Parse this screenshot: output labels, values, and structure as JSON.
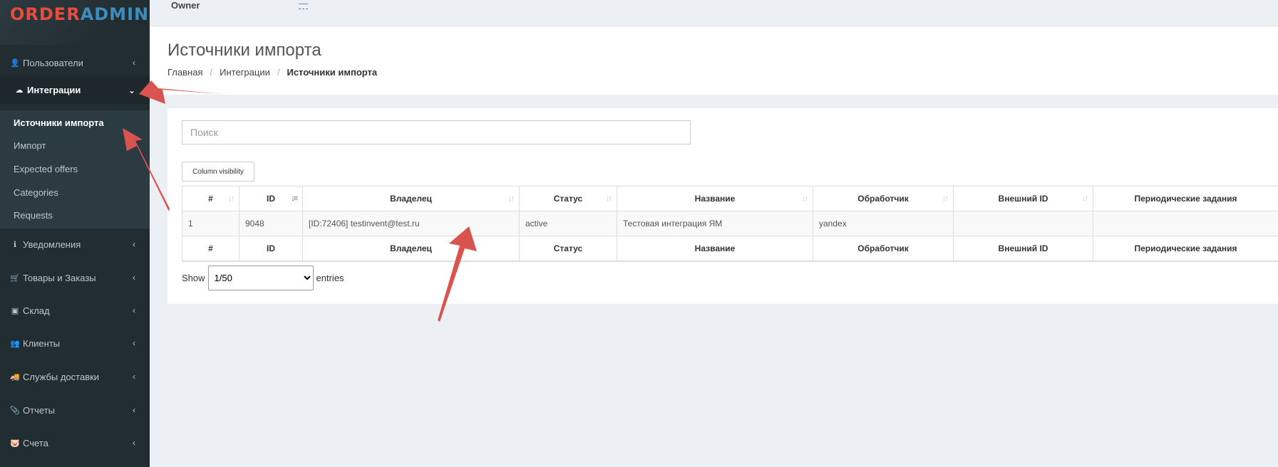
{
  "logo": {
    "part1": "ORDER",
    "part2": "ADMIN"
  },
  "topbar": {
    "owner_label": "Owner",
    "owner_value": "—"
  },
  "sidebar": {
    "items": [
      {
        "label": "Пользователи",
        "icon": "user-icon",
        "glyph": "👤"
      },
      {
        "label": "Интеграции",
        "icon": "cloud-download-icon",
        "glyph": "☁"
      },
      {
        "label": "Уведомления",
        "icon": "info-icon",
        "glyph": "ℹ"
      },
      {
        "label": "Товары и Заказы",
        "icon": "cart-icon",
        "glyph": "🛒"
      },
      {
        "label": "Склад",
        "icon": "cubes-icon",
        "glyph": "▣"
      },
      {
        "label": "Клиенты",
        "icon": "users-icon",
        "glyph": "👥"
      },
      {
        "label": "Службы доставки",
        "icon": "truck-icon",
        "glyph": "🚚"
      },
      {
        "label": "Отчеты",
        "icon": "paperclip-icon",
        "glyph": "📎"
      },
      {
        "label": "Счета",
        "icon": "piggy-bank-icon",
        "glyph": "🐷"
      }
    ],
    "submenu": [
      "Источники импорта",
      "Импорт",
      "Expected offers",
      "Categories",
      "Requests"
    ]
  },
  "page": {
    "title": "Источники импорта",
    "breadcrumb": [
      "Главная",
      "Интеграции",
      "Источники импорта"
    ]
  },
  "search": {
    "placeholder": "Поиск"
  },
  "column_visibility_label": "Column visibility",
  "table": {
    "headers": [
      "#",
      "ID",
      "Владелец",
      "Статус",
      "Название",
      "Обработчик",
      "Внешний ID",
      "Периодические задания"
    ],
    "rows": [
      [
        "1",
        "9048",
        "[ID:72406] testinvent@test.ru",
        "active",
        "Тестовая интеграция ЯМ",
        "yandex",
        "",
        ""
      ]
    ]
  },
  "pagination": {
    "show_label": "Show",
    "selected": "1/50",
    "entries_label": "entries"
  },
  "colors": {
    "sidebar_bg": "#222d32",
    "logo_red": "#e74c3c",
    "logo_blue": "#3c8dbc",
    "annotation_arrow": "#d9534f"
  }
}
